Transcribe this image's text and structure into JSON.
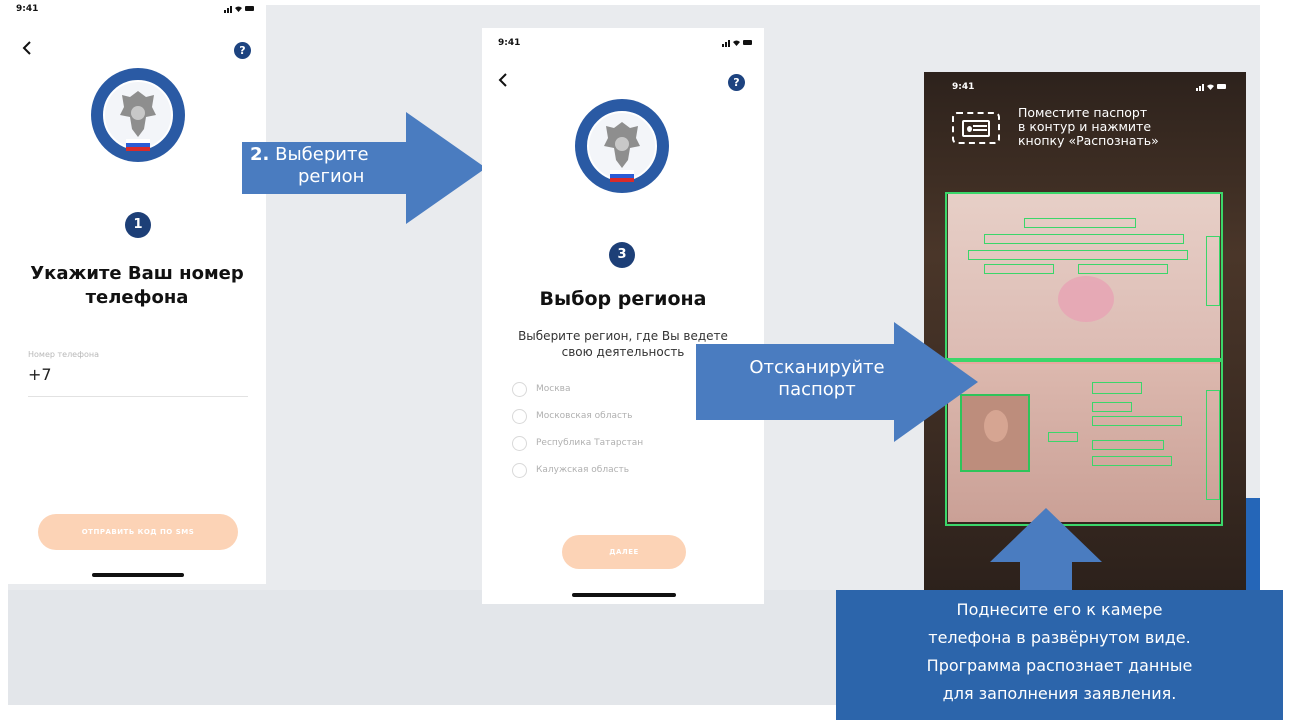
{
  "colors": {
    "brand_navy": "#1d3f77",
    "button_peach": "#fcd3b6",
    "arrow_blue": "#4a7cc0",
    "callout_blue": "#2c65ab",
    "scan_green": "#3bd66a"
  },
  "screen_phone": {
    "status_time": "9:41",
    "status_icons": "signal-wifi-battery",
    "back_icon": "chevron-left-icon",
    "help_icon": "question-icon",
    "help_label": "?",
    "emblem": "fns-emblem-icon",
    "step_number": "1",
    "title_line1": "Укажите Ваш номер",
    "title_line2": "телефона",
    "field_label": "Номер телефона",
    "field_value": "+7",
    "button_label": "ОТПРАВИТЬ КОД ПО SMS"
  },
  "arrow_region": {
    "number": "2.",
    "line1": "Выберите",
    "line2": "регион"
  },
  "screen_region": {
    "status_time": "9:41",
    "status_icons": "signal-wifi-battery",
    "back_icon": "chevron-left-icon",
    "help_icon": "question-icon",
    "help_label": "?",
    "emblem": "fns-emblem-icon",
    "step_number": "3",
    "title": "Выбор региона",
    "subtitle_line1": "Выберите регион, где Вы ведете",
    "subtitle_line2": "свою деятельность",
    "regions": [
      "Москва",
      "Московская область",
      "Республика Татарстан",
      "Калужская область"
    ],
    "button_label": "ДАЛЕЕ"
  },
  "arrow_scan": {
    "line1": "Отсканируйте",
    "line2": "паспорт"
  },
  "screen_camera": {
    "status_time": "9:41",
    "status_icons": "signal-wifi-battery",
    "hint_icon": "passport-scan-icon",
    "hint_line1": "Поместите паспорт",
    "hint_line2": "в контур и нажмите",
    "hint_line3": "кнопку «Распознать»"
  },
  "callout": {
    "line1": "Поднесите его  к камере",
    "line2": "телефона в развёрнутом виде.",
    "line3": "Программа распознает данные",
    "line4": "для заполнения заявления."
  }
}
